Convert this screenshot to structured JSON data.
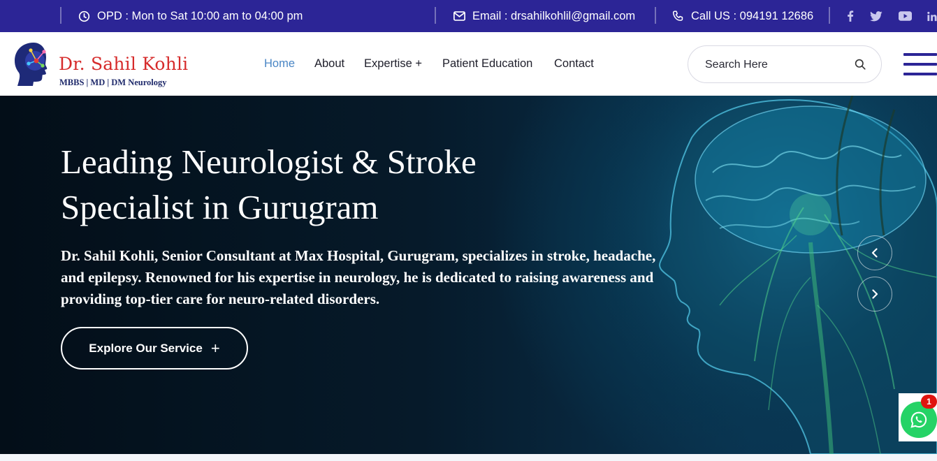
{
  "topbar": {
    "opd": "OPD : Mon to Sat 10:00 am to 04:00 pm",
    "email": "Email : drsahilkohlil@gmail.com",
    "phone": "Call US : 094191 12686",
    "social": [
      "facebook-icon",
      "twitter-icon",
      "youtube-icon",
      "linkedin-icon"
    ],
    "bg_color": "#2c2596"
  },
  "header": {
    "logo_name": "Dr. Sahil Kohli",
    "logo_sub": "MBBS | MD | DM Neurology",
    "nav": [
      {
        "label": "Home",
        "active": true
      },
      {
        "label": "About"
      },
      {
        "label": "Expertise +"
      },
      {
        "label": "Patient Education"
      },
      {
        "label": "Contact"
      }
    ],
    "search_placeholder": "Search Here",
    "accent_color": "#4a86c5",
    "brand_color": "#d62b2b"
  },
  "hero": {
    "title": "Leading Neurologist & Stroke Specialist in Gurugram",
    "description": "Dr. Sahil Kohli, Senior Consultant at Max Hospital, Gurugram, specializes in stroke, headache, and epilepsy. Renowned for his expertise in neurology, he is dedicated to raising awareness and providing top-tier care for neuro-related disorders.",
    "cta": "Explore Our Service",
    "cta_icon": "plus-icon",
    "prev_icon": "chevron-left-icon",
    "next_icon": "chevron-right-icon"
  },
  "whatsapp": {
    "icon": "whatsapp-icon",
    "badge": "1",
    "color": "#25d366"
  }
}
